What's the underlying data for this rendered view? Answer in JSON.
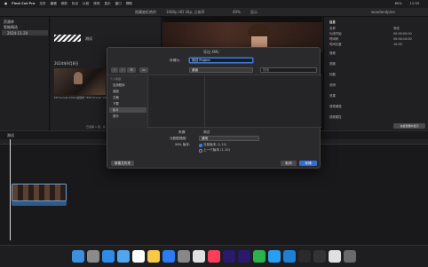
{
  "menubar": {
    "items": [
      "Final Cut Pro",
      "文件",
      "编辑",
      "修剪",
      "标记",
      "片段",
      "修改",
      "显示",
      "窗口",
      "帮助"
    ],
    "right_items": [
      "80%",
      "11:30"
    ]
  },
  "toolbar": {
    "center_label": "隐藏被拒绝的",
    "viewer_info": "1080p HD 30p, 立体声",
    "zoom": "49%",
    "view_label": "显示",
    "inspector_title": "woodandpine"
  },
  "sidebar": {
    "library": "资源库",
    "event": "2024-11-20",
    "smart": "智能精选"
  },
  "browser": {
    "clip1_label": "测试",
    "date_label": "2024年9月8日",
    "thumb_caption": "EM Sunset 2024 拍摄的 \"Edit Scene\" 2024",
    "footer": "已选择 1 项，共 2 项，10:00"
  },
  "inspector": {
    "section": "信息",
    "rows": [
      "名称",
      "片段开始",
      "时间码",
      "时间长度"
    ],
    "values": [
      "测试",
      "00:00:00:00",
      "00:00:10:00",
      "10:00"
    ],
    "checks": [
      "音频",
      "视频",
      "标题",
      "说明",
      "效果",
      "音频增强",
      "视频属性",
      "元数据"
    ],
    "bottom_btn": "在检查器中显示"
  },
  "timeline": {
    "project": "测试",
    "timecode": "00:00:00:00"
  },
  "dialog": {
    "title": "导出 XML",
    "save_as_label": "存储为:",
    "save_as_value": "测试 Project",
    "tags_label": "标签:",
    "location": "桌面",
    "search_placeholder": "搜索",
    "sidebar": {
      "section": "个人收藏",
      "items": [
        "应用程序",
        "桌面",
        "文稿",
        "下载",
        "影片",
        "音乐"
      ]
    },
    "source_label": "来源:",
    "source_value": "测试",
    "metadata_label": "元数据视图:",
    "metadata_value": "通用",
    "xml_label": "XML 版本:",
    "xml_options": [
      "当前版本 (1.11)",
      "上一个版本 (1.10)"
    ],
    "new_folder": "新建文件夹",
    "cancel": "取消",
    "save": "存储"
  },
  "dock": {
    "icons": [
      "Fi",
      "La",
      "Sa",
      "Ma",
      "Ca",
      "No",
      "Ap",
      "Sy",
      "Ph",
      "Mu",
      "Pr",
      "Pr",
      "We",
      "Qq",
      "Vs",
      "Fc",
      "Co",
      "Ch",
      "Tr"
    ],
    "colors": [
      "#3d8fe0",
      "#8b8b8b",
      "#2c8ce8",
      "#4fa7f0",
      "#ffffff",
      "#f7c948",
      "#2b7cf0",
      "#888888",
      "#e0e0e0",
      "#fa3f5a",
      "#2a1a6e",
      "#2a1a6e",
      "#2bb24c",
      "#2a9df4",
      "#1e7fd6",
      "#2a2a2a",
      "#333333",
      "#e0e0e0",
      "#6a6a6a"
    ]
  }
}
